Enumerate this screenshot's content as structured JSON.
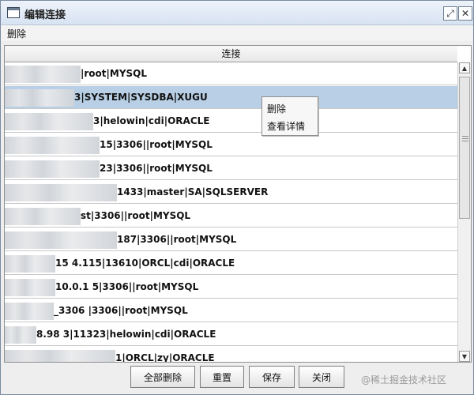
{
  "window": {
    "title": "编辑连接"
  },
  "menubar": {
    "delete_label": "删除"
  },
  "table": {
    "header": "连接",
    "rows": [
      {
        "text": "|root|MYSQL",
        "selected": false
      },
      {
        "text": "3|SYSTEM|SYSDBA|XUGU",
        "selected": true
      },
      {
        "text": "3|helowin|cdi|ORACLE",
        "selected": false
      },
      {
        "text": "15|3306||root|MYSQL",
        "selected": false
      },
      {
        "text": "23|3306||root|MYSQL",
        "selected": false
      },
      {
        "text": "1433|master|SA|SQLSERVER",
        "selected": false
      },
      {
        "text": "st|3306||root|MYSQL",
        "selected": false
      },
      {
        "text": "187|3306||root|MYSQL",
        "selected": false
      },
      {
        "text": "15 4.115|13610|ORCL|cdi|ORACLE",
        "selected": false
      },
      {
        "text": "10.0.1 5|3306||root|MYSQL",
        "selected": false
      },
      {
        "text": "_3306 |3306||root|MYSQL",
        "selected": false
      },
      {
        "text": "8.98 3|11323|helowin|cdi|ORACLE",
        "selected": false
      },
      {
        "text": "1|ORCL|zy|ORACLE",
        "selected": false
      }
    ]
  },
  "context_menu": {
    "items": [
      {
        "label": "删除"
      },
      {
        "label": "查看详情"
      }
    ]
  },
  "buttons": {
    "clear_all": "全部删除",
    "reset": "重置",
    "save": "保存",
    "close": "关闭"
  },
  "watermark": "@稀土掘金技术社区"
}
